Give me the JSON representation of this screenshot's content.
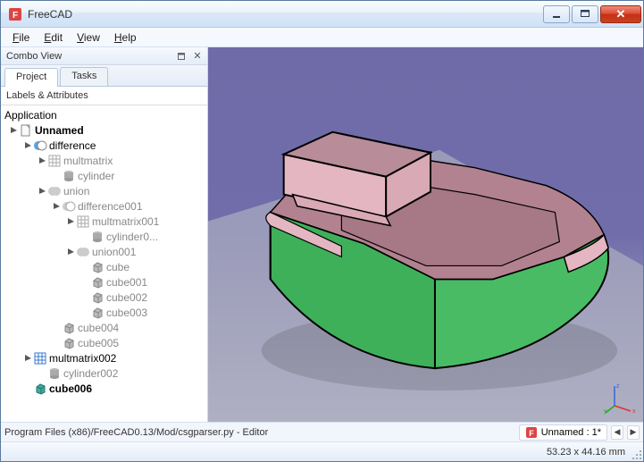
{
  "title": "FreeCAD",
  "menu": {
    "file": "File",
    "edit": "Edit",
    "view": "View",
    "help": "Help"
  },
  "panel": {
    "title": "Combo View",
    "tabs": {
      "project": "Project",
      "tasks": "Tasks"
    },
    "section": "Labels & Attributes"
  },
  "tree": {
    "application": "Application",
    "unnamed": "Unnamed",
    "difference": "difference",
    "multmatrix": "multmatrix",
    "cylinder": "cylinder",
    "union": "union",
    "difference001": "difference001",
    "multmatrix001": "multmatrix001",
    "cylinder0": "cylinder0...",
    "union001": "union001",
    "cube": "cube",
    "cube001": "cube001",
    "cube002": "cube002",
    "cube003": "cube003",
    "cube004": "cube004",
    "cube005": "cube005",
    "multmatrix002": "multmatrix002",
    "cylinder002": "cylinder002",
    "cube006": "cube006"
  },
  "axis": {
    "x": "x",
    "y": "y",
    "z": "z"
  },
  "footer": {
    "path": "Program Files (x86)/FreeCAD0.13/Mod/csgparser.py - Editor",
    "doc": "Unnamed : 1*"
  },
  "status": {
    "dims": "53.23 x 44.16  mm"
  }
}
